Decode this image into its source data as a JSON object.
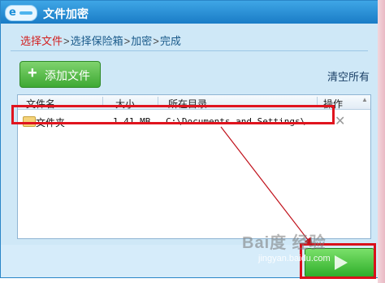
{
  "window": {
    "title": "文件加密",
    "logo_icon": "360-logo-icon"
  },
  "breadcrumb": {
    "steps": [
      "选择文件",
      "选择保险箱",
      "加密",
      "完成"
    ],
    "separator": ">"
  },
  "toolbar": {
    "add_label": "添加文件",
    "clear_label": "清空所有"
  },
  "list": {
    "columns": [
      "文件名",
      "大小",
      "所在目录",
      "操作"
    ],
    "rows": [
      {
        "name": "文件夹",
        "size": "1.41 MB",
        "dir": "C:\\Documents and Settings\\...",
        "action_icon": "close-icon"
      }
    ]
  },
  "footer": {
    "next_icon": "play-icon"
  },
  "watermark": {
    "logo": "Bai度 经验",
    "url": "jingyan.baidu.com"
  },
  "colors": {
    "accent": "#1a7cc6",
    "green": "#3ea933",
    "highlight_red": "#e0141e"
  }
}
